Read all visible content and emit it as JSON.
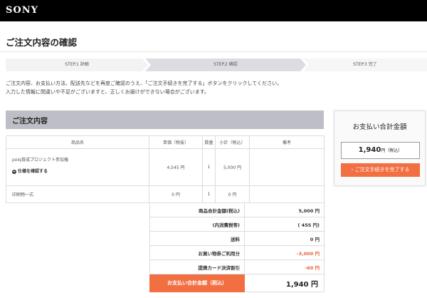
{
  "header": {
    "logo": "SONY"
  },
  "page": {
    "title": "ご注文内容の確認"
  },
  "steps": [
    {
      "label": "STEP.1 詳細"
    },
    {
      "label": "STEP.2 確認"
    },
    {
      "label": "STEP.3 完了"
    }
  ],
  "instructions": {
    "line1": "ご注文内容、お支払い方法、配送先などを再度ご確認のうえ、「ご注文手続きを完了する」ボタンをクリックしてください。",
    "line2": "入力した情報に間違いや不足がございますと、正しくお届けができない場合がございます。"
  },
  "order": {
    "section_title": "ご注文内容",
    "headers": [
      "商品名",
      "単価（税抜）",
      "数量",
      "小計（税込）",
      "備考"
    ],
    "rows": [
      {
        "name": "poiq育成プロジェクト参加権",
        "link": "仕様を確認する",
        "price": "4,545 円",
        "qty": "1",
        "subtotal": "5,000 円",
        "note": ""
      },
      {
        "name": "印刷物一式",
        "price": "0 円",
        "qty": "1",
        "subtotal": "0 円",
        "note": ""
      }
    ]
  },
  "summary": {
    "rows": [
      {
        "label": "商品合計金額(税込)",
        "value": "5,000 円"
      },
      {
        "label": "(内消費税等)",
        "value": "( 455 円)"
      },
      {
        "label": "送料",
        "value": "0 円"
      },
      {
        "label": "お買い物券ご利用分",
        "value": "-3,000 円"
      },
      {
        "label": "提携カード決済割引",
        "value": "-60 円"
      }
    ],
    "total_label": "お支払い合計金額（税込）",
    "total_value": "1,940 円"
  },
  "side": {
    "title": "お支払い合計金額",
    "amount": "1,940",
    "amount_suffix": "円（税込）",
    "button_label": "› ご注文手続きを完了する"
  },
  "colors": {
    "accent": "#f26f42",
    "discount": "#e8603c",
    "section_bg": "#bebfc6"
  }
}
